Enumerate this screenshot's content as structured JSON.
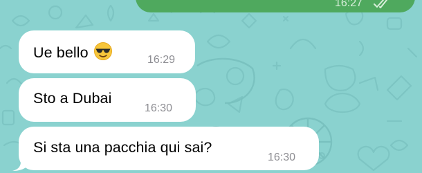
{
  "chat": {
    "messages": [
      {
        "id": "outgoing-partial",
        "direction": "outgoing",
        "text": "",
        "time": "16:27",
        "status": "read",
        "status_icon": "double-check-icon"
      },
      {
        "id": "msg-1",
        "direction": "incoming",
        "text": "Ue bello",
        "emoji": "smiling-face-with-sunglasses-icon",
        "time": "16:29"
      },
      {
        "id": "msg-2",
        "direction": "incoming",
        "text": "Sto a Dubai",
        "time": "16:30"
      },
      {
        "id": "msg-3",
        "direction": "incoming",
        "text": "Si sta una pacchia qui sai?",
        "time": "16:30"
      }
    ]
  },
  "colors": {
    "wallpaper": "#8ad2cf",
    "incoming_bubble": "#ffffff",
    "outgoing_bubble": "#4fa95e",
    "timestamp": "#8e8e93"
  }
}
